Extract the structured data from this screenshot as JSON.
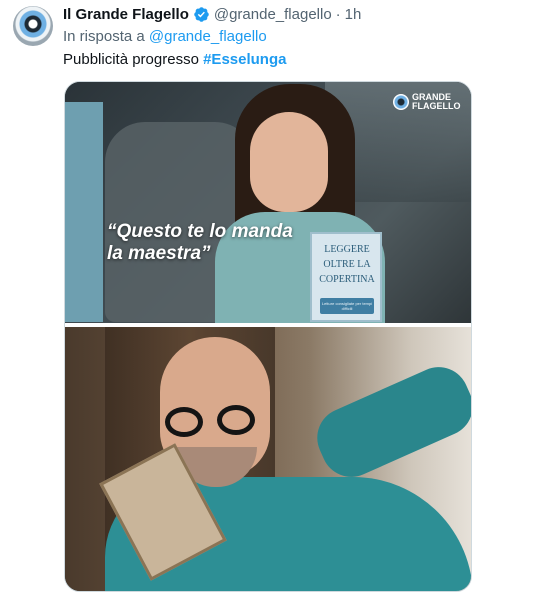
{
  "tweet": {
    "display_name": "Il Grande Flagello",
    "handle": "@grande_flagello",
    "separator": "·",
    "time": "1h",
    "reply_prefix": "In risposta a",
    "reply_handle": "@grande_flagello",
    "text_prefix": "Pubblicità progresso",
    "hashtag": "#Esselunga"
  },
  "media": {
    "quote_line1": "“Questo te lo manda",
    "quote_line2": "la maestra”",
    "watermark_line1": "GRANDE",
    "watermark_line2": "FLAGELLO",
    "book_title_line1": "LEGGERE",
    "book_title_line2": "OLTRE LA",
    "book_title_line3": "COPERTINA",
    "book_band_text": "Letture consigliate per tempi difficili"
  },
  "colors": {
    "link": "#1d9bf0",
    "secondary_text": "#536471",
    "primary_text": "#0f1419",
    "verified_badge": "#1d9bf0"
  },
  "icons": {
    "verified": "verified-badge-icon",
    "avatar": "eye-logo"
  }
}
